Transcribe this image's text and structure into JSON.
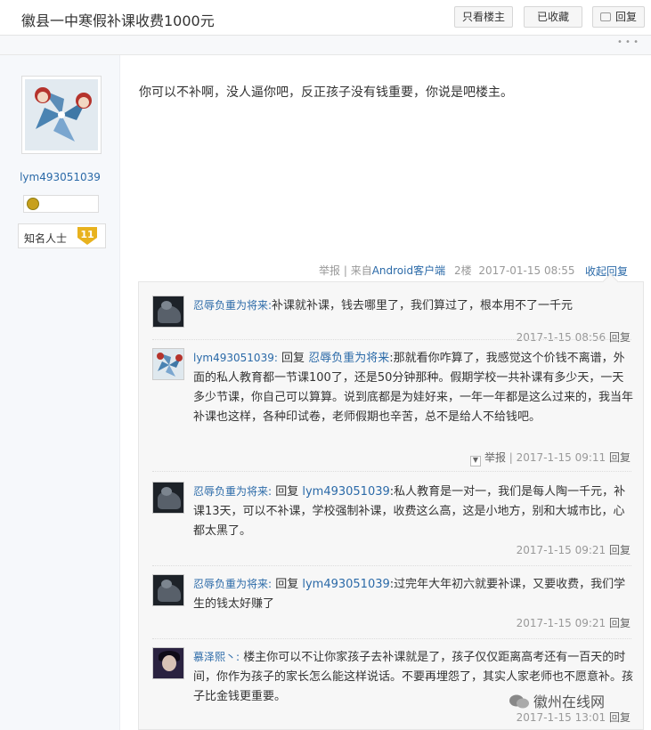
{
  "header": {
    "title": "徽县一中寒假补课收费1000元",
    "only_op_label": "只看楼主",
    "collected_label": "已收藏",
    "reply_label": "回复"
  },
  "strip": {
    "more": "• • •"
  },
  "author": {
    "username": "lym493051039",
    "rank_label": "知名人士",
    "rank_level": "11"
  },
  "post": {
    "content": "你可以不补啊，没人逼你吧，反正孩子没有钱重要，你说是吧楼主。",
    "report_label": "举报",
    "source_prefix": " | 来自",
    "source_link": "Android客户端",
    "floor": "2楼",
    "time": "2017-01-15 08:55",
    "collapse_label": "收起回复"
  },
  "replies": [
    {
      "user": "忍辱负重为将来:",
      "reply_word": "",
      "mention": "",
      "text": "补课就补课，钱去哪里了，我们算过了，根本用不了一千元",
      "time": "2017-1-15 08:56",
      "reply_label": "回复"
    },
    {
      "user": "lym493051039:",
      "reply_word": "回复",
      "mention": "忍辱负重为将来",
      "text": ":那就看你咋算了，我感觉这个价钱不离谱，外面的私人教育都一节课100了，还是50分钟那种。假期学校一共补课有多少天，一天多少节课，你自己可以算算。说到底都是为娃好来，一年一年都是这么过来的，我当年补课也这样，各种印试卷，老师假期也辛苦，总不是给人不给钱吧。",
      "report_label": "举报",
      "time": "2017-1-15 09:11",
      "reply_label": "回复"
    },
    {
      "user": "忍辱负重为将来:",
      "reply_word": "回复",
      "mention": "lym493051039",
      "text": ":私人教育是一对一，我们是每人陶一千元，补课13天，可以不补课，学校强制补课，收费这么高，这是小地方，别和大城市比，心都太黑了。",
      "time": "2017-1-15 09:21",
      "reply_label": "回复"
    },
    {
      "user": "忍辱负重为将来:",
      "reply_word": "回复",
      "mention": "lym493051039",
      "text": ":过完年大年初六就要补课，又要收费，我们学生的钱太好赚了",
      "time": "2017-1-15 09:21",
      "reply_label": "回复"
    },
    {
      "user": "慕泽熙丶:",
      "reply_word": "",
      "mention": "",
      "text": "楼主你可以不让你家孩子去补课就是了，孩子仅仅距离高考还有一百天的时间，你作为孩子的家长怎么能这样说话。不要再埋怨了，其实人家老师也不愿意补。孩子比金钱更重要。",
      "time": "2017-1-15 13:01",
      "reply_label": "回复"
    }
  ],
  "watermark": {
    "text": "徽州在线网"
  },
  "colors": {
    "link": "#2b6aa8",
    "muted": "#999999",
    "rank_badge": "#e8b21e"
  }
}
